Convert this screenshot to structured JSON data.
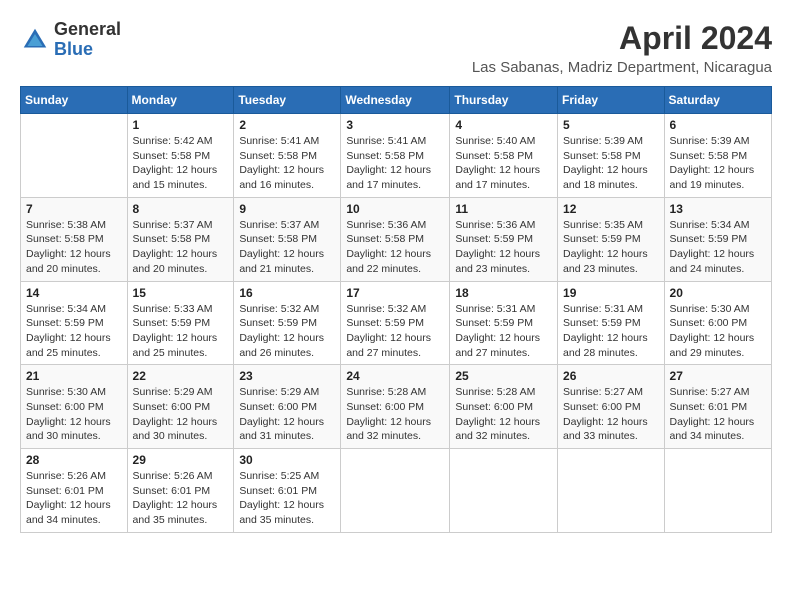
{
  "header": {
    "logo_general": "General",
    "logo_blue": "Blue",
    "month_title": "April 2024",
    "location": "Las Sabanas, Madriz Department, Nicaragua"
  },
  "calendar": {
    "days_of_week": [
      "Sunday",
      "Monday",
      "Tuesday",
      "Wednesday",
      "Thursday",
      "Friday",
      "Saturday"
    ],
    "weeks": [
      [
        {
          "day": "",
          "info": ""
        },
        {
          "day": "1",
          "info": "Sunrise: 5:42 AM\nSunset: 5:58 PM\nDaylight: 12 hours\nand 15 minutes."
        },
        {
          "day": "2",
          "info": "Sunrise: 5:41 AM\nSunset: 5:58 PM\nDaylight: 12 hours\nand 16 minutes."
        },
        {
          "day": "3",
          "info": "Sunrise: 5:41 AM\nSunset: 5:58 PM\nDaylight: 12 hours\nand 17 minutes."
        },
        {
          "day": "4",
          "info": "Sunrise: 5:40 AM\nSunset: 5:58 PM\nDaylight: 12 hours\nand 17 minutes."
        },
        {
          "day": "5",
          "info": "Sunrise: 5:39 AM\nSunset: 5:58 PM\nDaylight: 12 hours\nand 18 minutes."
        },
        {
          "day": "6",
          "info": "Sunrise: 5:39 AM\nSunset: 5:58 PM\nDaylight: 12 hours\nand 19 minutes."
        }
      ],
      [
        {
          "day": "7",
          "info": "Sunrise: 5:38 AM\nSunset: 5:58 PM\nDaylight: 12 hours\nand 20 minutes."
        },
        {
          "day": "8",
          "info": "Sunrise: 5:37 AM\nSunset: 5:58 PM\nDaylight: 12 hours\nand 20 minutes."
        },
        {
          "day": "9",
          "info": "Sunrise: 5:37 AM\nSunset: 5:58 PM\nDaylight: 12 hours\nand 21 minutes."
        },
        {
          "day": "10",
          "info": "Sunrise: 5:36 AM\nSunset: 5:58 PM\nDaylight: 12 hours\nand 22 minutes."
        },
        {
          "day": "11",
          "info": "Sunrise: 5:36 AM\nSunset: 5:59 PM\nDaylight: 12 hours\nand 23 minutes."
        },
        {
          "day": "12",
          "info": "Sunrise: 5:35 AM\nSunset: 5:59 PM\nDaylight: 12 hours\nand 23 minutes."
        },
        {
          "day": "13",
          "info": "Sunrise: 5:34 AM\nSunset: 5:59 PM\nDaylight: 12 hours\nand 24 minutes."
        }
      ],
      [
        {
          "day": "14",
          "info": "Sunrise: 5:34 AM\nSunset: 5:59 PM\nDaylight: 12 hours\nand 25 minutes."
        },
        {
          "day": "15",
          "info": "Sunrise: 5:33 AM\nSunset: 5:59 PM\nDaylight: 12 hours\nand 25 minutes."
        },
        {
          "day": "16",
          "info": "Sunrise: 5:32 AM\nSunset: 5:59 PM\nDaylight: 12 hours\nand 26 minutes."
        },
        {
          "day": "17",
          "info": "Sunrise: 5:32 AM\nSunset: 5:59 PM\nDaylight: 12 hours\nand 27 minutes."
        },
        {
          "day": "18",
          "info": "Sunrise: 5:31 AM\nSunset: 5:59 PM\nDaylight: 12 hours\nand 27 minutes."
        },
        {
          "day": "19",
          "info": "Sunrise: 5:31 AM\nSunset: 5:59 PM\nDaylight: 12 hours\nand 28 minutes."
        },
        {
          "day": "20",
          "info": "Sunrise: 5:30 AM\nSunset: 6:00 PM\nDaylight: 12 hours\nand 29 minutes."
        }
      ],
      [
        {
          "day": "21",
          "info": "Sunrise: 5:30 AM\nSunset: 6:00 PM\nDaylight: 12 hours\nand 30 minutes."
        },
        {
          "day": "22",
          "info": "Sunrise: 5:29 AM\nSunset: 6:00 PM\nDaylight: 12 hours\nand 30 minutes."
        },
        {
          "day": "23",
          "info": "Sunrise: 5:29 AM\nSunset: 6:00 PM\nDaylight: 12 hours\nand 31 minutes."
        },
        {
          "day": "24",
          "info": "Sunrise: 5:28 AM\nSunset: 6:00 PM\nDaylight: 12 hours\nand 32 minutes."
        },
        {
          "day": "25",
          "info": "Sunrise: 5:28 AM\nSunset: 6:00 PM\nDaylight: 12 hours\nand 32 minutes."
        },
        {
          "day": "26",
          "info": "Sunrise: 5:27 AM\nSunset: 6:00 PM\nDaylight: 12 hours\nand 33 minutes."
        },
        {
          "day": "27",
          "info": "Sunrise: 5:27 AM\nSunset: 6:01 PM\nDaylight: 12 hours\nand 34 minutes."
        }
      ],
      [
        {
          "day": "28",
          "info": "Sunrise: 5:26 AM\nSunset: 6:01 PM\nDaylight: 12 hours\nand 34 minutes."
        },
        {
          "day": "29",
          "info": "Sunrise: 5:26 AM\nSunset: 6:01 PM\nDaylight: 12 hours\nand 35 minutes."
        },
        {
          "day": "30",
          "info": "Sunrise: 5:25 AM\nSunset: 6:01 PM\nDaylight: 12 hours\nand 35 minutes."
        },
        {
          "day": "",
          "info": ""
        },
        {
          "day": "",
          "info": ""
        },
        {
          "day": "",
          "info": ""
        },
        {
          "day": "",
          "info": ""
        }
      ]
    ]
  }
}
